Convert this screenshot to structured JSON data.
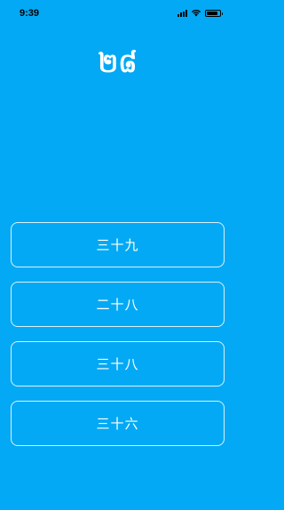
{
  "status_bar": {
    "time": "9:39",
    "icons": [
      "signal-icon",
      "wifi-icon",
      "battery-icon"
    ],
    "battery_level": 0.85
  },
  "question": {
    "text": "២៨"
  },
  "answers": [
    {
      "label": "三十九"
    },
    {
      "label": "二十八"
    },
    {
      "label": "三十八"
    },
    {
      "label": "三十六"
    }
  ],
  "colors": {
    "background": "#03a9f4",
    "text": "#ffffff",
    "button_border": "#ffffff"
  }
}
